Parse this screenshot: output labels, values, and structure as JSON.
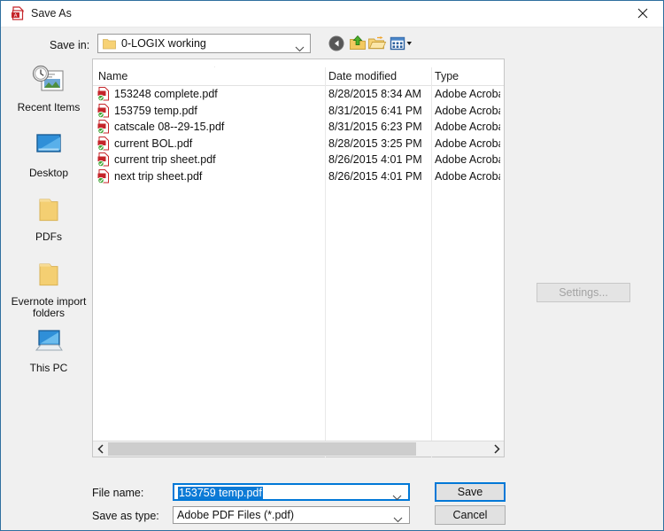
{
  "window": {
    "title": "Save As",
    "title_icon": "pdf-icon",
    "close_label": "✕"
  },
  "savein": {
    "label": "Save in:",
    "value": "0-LOGIX working",
    "icon": "folder-icon"
  },
  "toolbar": {
    "back": "back-icon",
    "up": "up-folder-icon",
    "new_folder": "new-folder-icon",
    "views": "views-icon"
  },
  "places": {
    "items": [
      {
        "label": "Recent Items",
        "icon": "recent-items-icon"
      },
      {
        "label": "Desktop",
        "icon": "desktop-icon"
      },
      {
        "label": "PDFs",
        "icon": "folder-icon"
      },
      {
        "label": "Evernote import folders",
        "icon": "folder-icon"
      },
      {
        "label": "This PC",
        "icon": "this-pc-icon"
      }
    ]
  },
  "filelist": {
    "columns": [
      "Name",
      "Date modified",
      "Type"
    ],
    "sort_indicator": "˄",
    "rows": [
      {
        "name": "153248 complete.pdf",
        "date": "8/28/2015 8:34 AM",
        "type": "Adobe Acrobat"
      },
      {
        "name": "153759 temp.pdf",
        "date": "8/31/2015 6:41 PM",
        "type": "Adobe Acrobat"
      },
      {
        "name": "catscale 08--29-15.pdf",
        "date": "8/31/2015 6:23 PM",
        "type": "Adobe Acrobat"
      },
      {
        "name": "current BOL.pdf",
        "date": "8/28/2015 3:25 PM",
        "type": "Adobe Acrobat"
      },
      {
        "name": "current trip sheet.pdf",
        "date": "8/26/2015 4:01 PM",
        "type": "Adobe Acrobat"
      },
      {
        "name": "next trip sheet.pdf",
        "date": "8/26/2015 4:01 PM",
        "type": "Adobe Acrobat"
      }
    ],
    "scroll_left_arrow": "‹",
    "scroll_right_arrow": "›"
  },
  "settings_button": {
    "label": "Settings...",
    "enabled": false
  },
  "form": {
    "filename_label": "File name:",
    "filename_value": "153759 temp.pdf",
    "savetype_label": "Save as type:",
    "savetype_value": "Adobe PDF Files (*.pdf)"
  },
  "buttons": {
    "save": "Save",
    "cancel": "Cancel"
  },
  "colors": {
    "window_border": "#2f6f9f",
    "focus_blue": "#0078d7",
    "selection_blue": "#0c7ad6",
    "pdf_red": "#c5252a",
    "folder_yellow": "#f7d275",
    "disabled_text": "#a3a3a3"
  }
}
